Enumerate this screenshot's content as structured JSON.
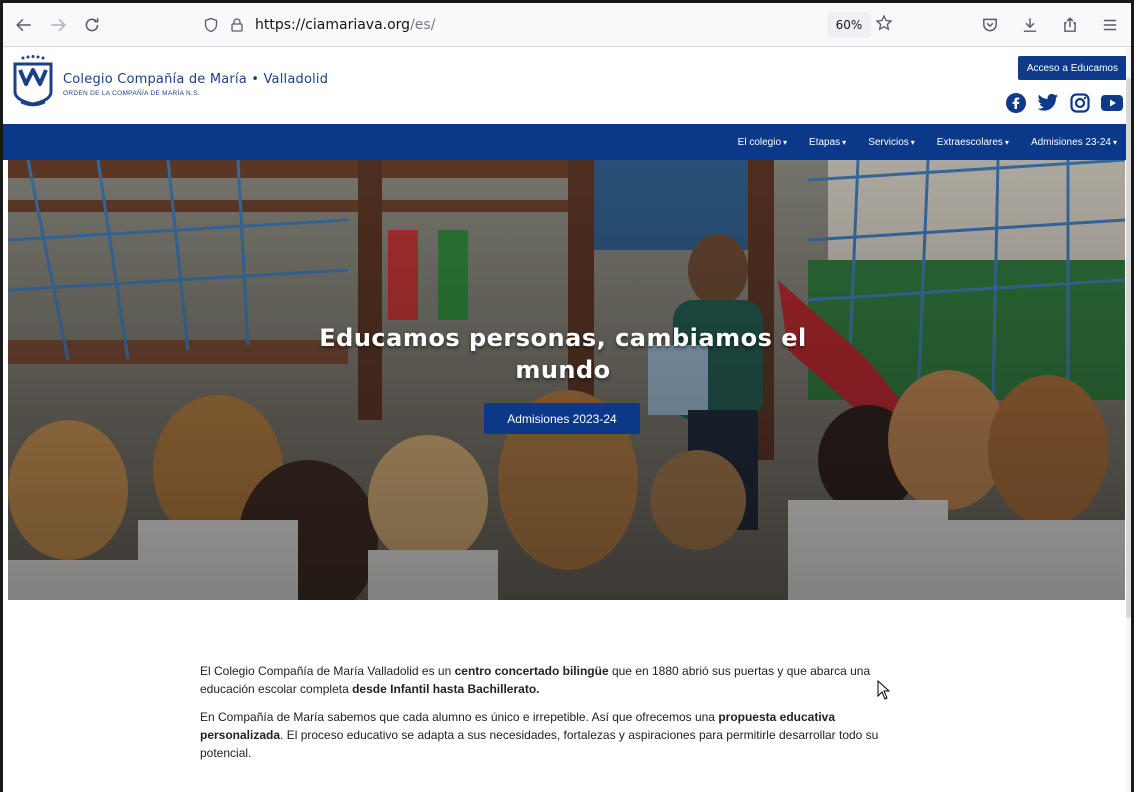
{
  "browser": {
    "url_host": "https://ciamariava.org",
    "url_path": "/es/",
    "zoom": "60%"
  },
  "header": {
    "brand_name": "Colegio Compañía de María • Valladolid",
    "brand_sub": "ORDEN DE LA COMPAÑÍA DE MARÍA N.S.",
    "access_button": "Acceso a Educamos"
  },
  "nav": {
    "items": [
      {
        "label": "El colegio",
        "has_dropdown": true
      },
      {
        "label": "Etapas",
        "has_dropdown": true
      },
      {
        "label": "Servicios",
        "has_dropdown": true
      },
      {
        "label": "Extraescolares",
        "has_dropdown": true
      },
      {
        "label": "Admisiones 23-24",
        "has_dropdown": true
      }
    ],
    "caret": "▾"
  },
  "hero": {
    "title": "Educamos personas, cambiamos el mundo",
    "button": "Admisiones 2023-24"
  },
  "content": {
    "p1_a": "El Colegio Compañía de María Valladolid es un ",
    "p1_b": "centro concertado bilingüe",
    "p1_c": " que en 1880 abrió sus puertas y que abarca una educación escolar completa ",
    "p1_d": "desde Infantil hasta Bachillerato.",
    "p2_a": "En Compañía de María sabemos que cada alumno es único e irrepetible. Así que ofrecemos una ",
    "p2_b": "propuesta educativa personalizada",
    "p2_c": ". El proceso educativo se adapta a sus necesidades, fortalezas y aspiraciones para permitirle desarrollar todo su potencial."
  },
  "colors": {
    "brand_blue": "#0b3889",
    "facebook": "#0f3a8a"
  },
  "icons": [
    "back-icon",
    "forward-icon",
    "reload-icon",
    "shield-icon",
    "lock-icon",
    "star-icon",
    "pocket-icon",
    "download-icon",
    "share-icon",
    "menu-icon",
    "facebook-icon",
    "twitter-icon",
    "instagram-icon",
    "youtube-icon"
  ]
}
